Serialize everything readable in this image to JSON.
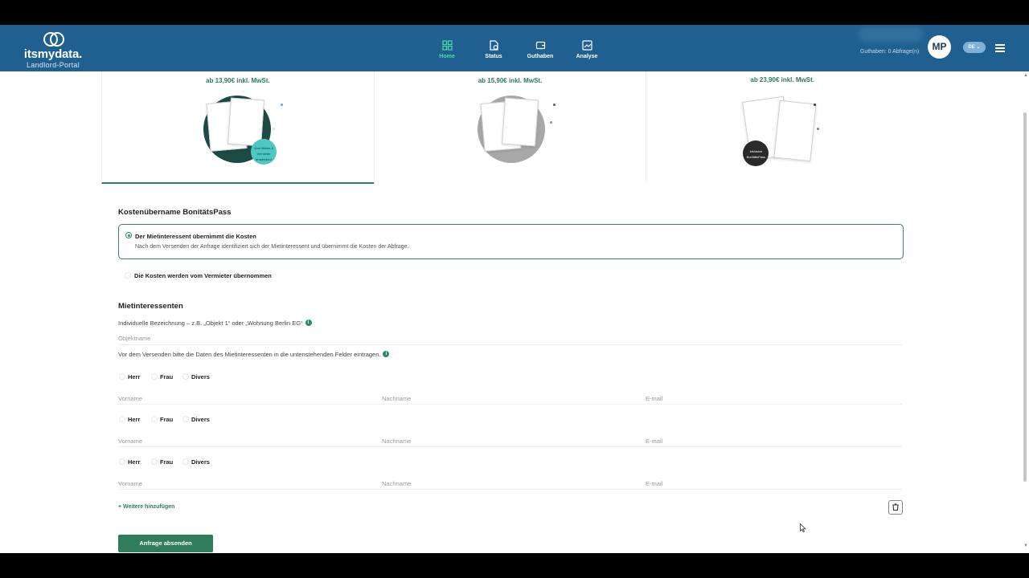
{
  "brand": {
    "name": "itsmydata.",
    "subtitle": "Landlord-Portal"
  },
  "nav": [
    {
      "label": "Home",
      "icon": "grid-icon",
      "active": true
    },
    {
      "label": "Status",
      "icon": "status-icon",
      "active": false
    },
    {
      "label": "Guthaben",
      "icon": "wallet-icon",
      "active": false
    },
    {
      "label": "Analyse",
      "icon": "analysis-icon",
      "active": false
    }
  ],
  "header": {
    "balance": "Guthaben: 0 Abfrage(n)",
    "avatar_initials": "MP",
    "language": "DE"
  },
  "products": [
    {
      "price": "ab 13,90€ inkl. MwSt.",
      "badge": "Vom Mieter & Vermieter empfohlen!",
      "active": true
    },
    {
      "price": "ab 15,90€ inkl. MwSt.",
      "active": false
    },
    {
      "price": "ab 23,90€ inkl. MwSt.",
      "badge": "Inklusive BonitätsPass",
      "active": false
    }
  ],
  "costs": {
    "title": "Kostenübername BonitätsPass",
    "option1_title": "Der Mietinteressent übernimmt die Kosten",
    "option1_desc": "Nach dem Versenden der Anfrage identifiziert sich der Mietinteressent und übernimmt die Kosten der Abfrage.",
    "option2_title": "Die Kosten werden vom Vermieter übernommen",
    "selected": 1
  },
  "applicants": {
    "title": "Mietinteressenten",
    "label_name": "Individuelle Bezeichnung – z.B. „Objekt 1“ oder „Wohnung Berlin EG“",
    "object_placeholder": "Objektname",
    "hint": "Vor dem Versenden bitte die Daten des Mietinteressenten in die untenstehenden Felder eintragen.",
    "genders": [
      "Herr",
      "Frau",
      "Divers"
    ],
    "placeholders": {
      "first": "Vorname",
      "last": "Nachname",
      "email": "E-mail"
    },
    "add_more": "+ Weitere hinzufügen",
    "submit": "Anfrage absenden"
  },
  "colors": {
    "header": "#1f6090",
    "accent": "#2f7d5b",
    "active_nav": "#4fdba8"
  }
}
